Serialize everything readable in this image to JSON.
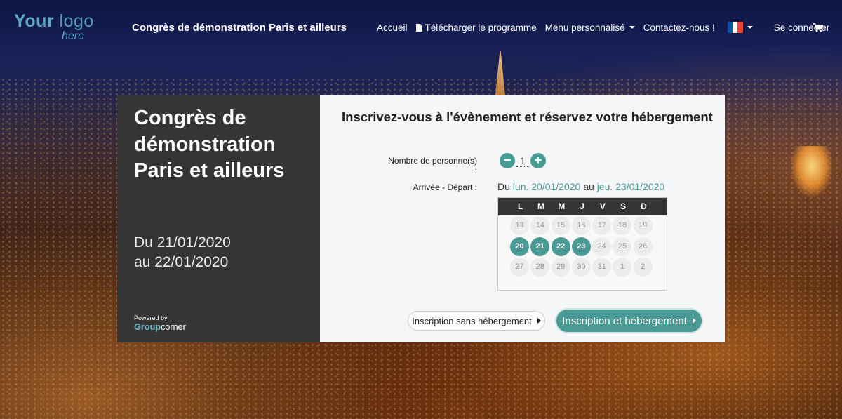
{
  "header": {
    "logo_main_bold": "Your",
    "logo_main_light": "logo",
    "logo_sub": "here",
    "event_name": "Congrès de démonstration Paris et ailleurs",
    "nav": {
      "home": "Accueil",
      "download": "Télécharger le programme",
      "custom_menu": "Menu personnalisé",
      "contact": "Contactez-nous !",
      "login": "Se connecter"
    },
    "flag_colors": [
      "#0055a4",
      "#ffffff",
      "#ef4135"
    ]
  },
  "event": {
    "title": "Congrès de démonstration Paris et ailleurs",
    "date_from": "Du 21/01/2020",
    "date_to": "au 22/01/2020",
    "powered_by": "Powered by",
    "brand_bold": "Group",
    "brand_light": "corner"
  },
  "booking": {
    "heading": "Inscrivez-vous à l'évènement et réservez votre hébergement",
    "persons_label": "Nombre de personne(s) :",
    "persons_minus": "−",
    "persons_value": "1",
    "persons_plus": "+",
    "dates_label": "Arrivée - Départ :",
    "range_prefix": "Du",
    "range_start": "lun. 20/01/2020",
    "range_mid": "au",
    "range_end": "jeu. 23/01/2020",
    "calendar": {
      "weekdays": [
        "L",
        "M",
        "M",
        "J",
        "V",
        "S",
        "D"
      ],
      "rows": [
        [
          "13",
          "14",
          "15",
          "16",
          "17",
          "18",
          "19"
        ],
        [
          "20",
          "21",
          "22",
          "23",
          "24",
          "25",
          "26"
        ],
        [
          "27",
          "28",
          "29",
          "30",
          "31",
          "1",
          "2"
        ]
      ],
      "selected": [
        "20",
        "21",
        "22",
        "23"
      ]
    },
    "btn_no_hotel": "Inscription sans hébergement",
    "btn_with_hotel": "Inscription et hébergement"
  },
  "colors": {
    "accent": "#4a9a95",
    "dark_panel": "#353535",
    "logo_blue": "#5aa9c9"
  }
}
